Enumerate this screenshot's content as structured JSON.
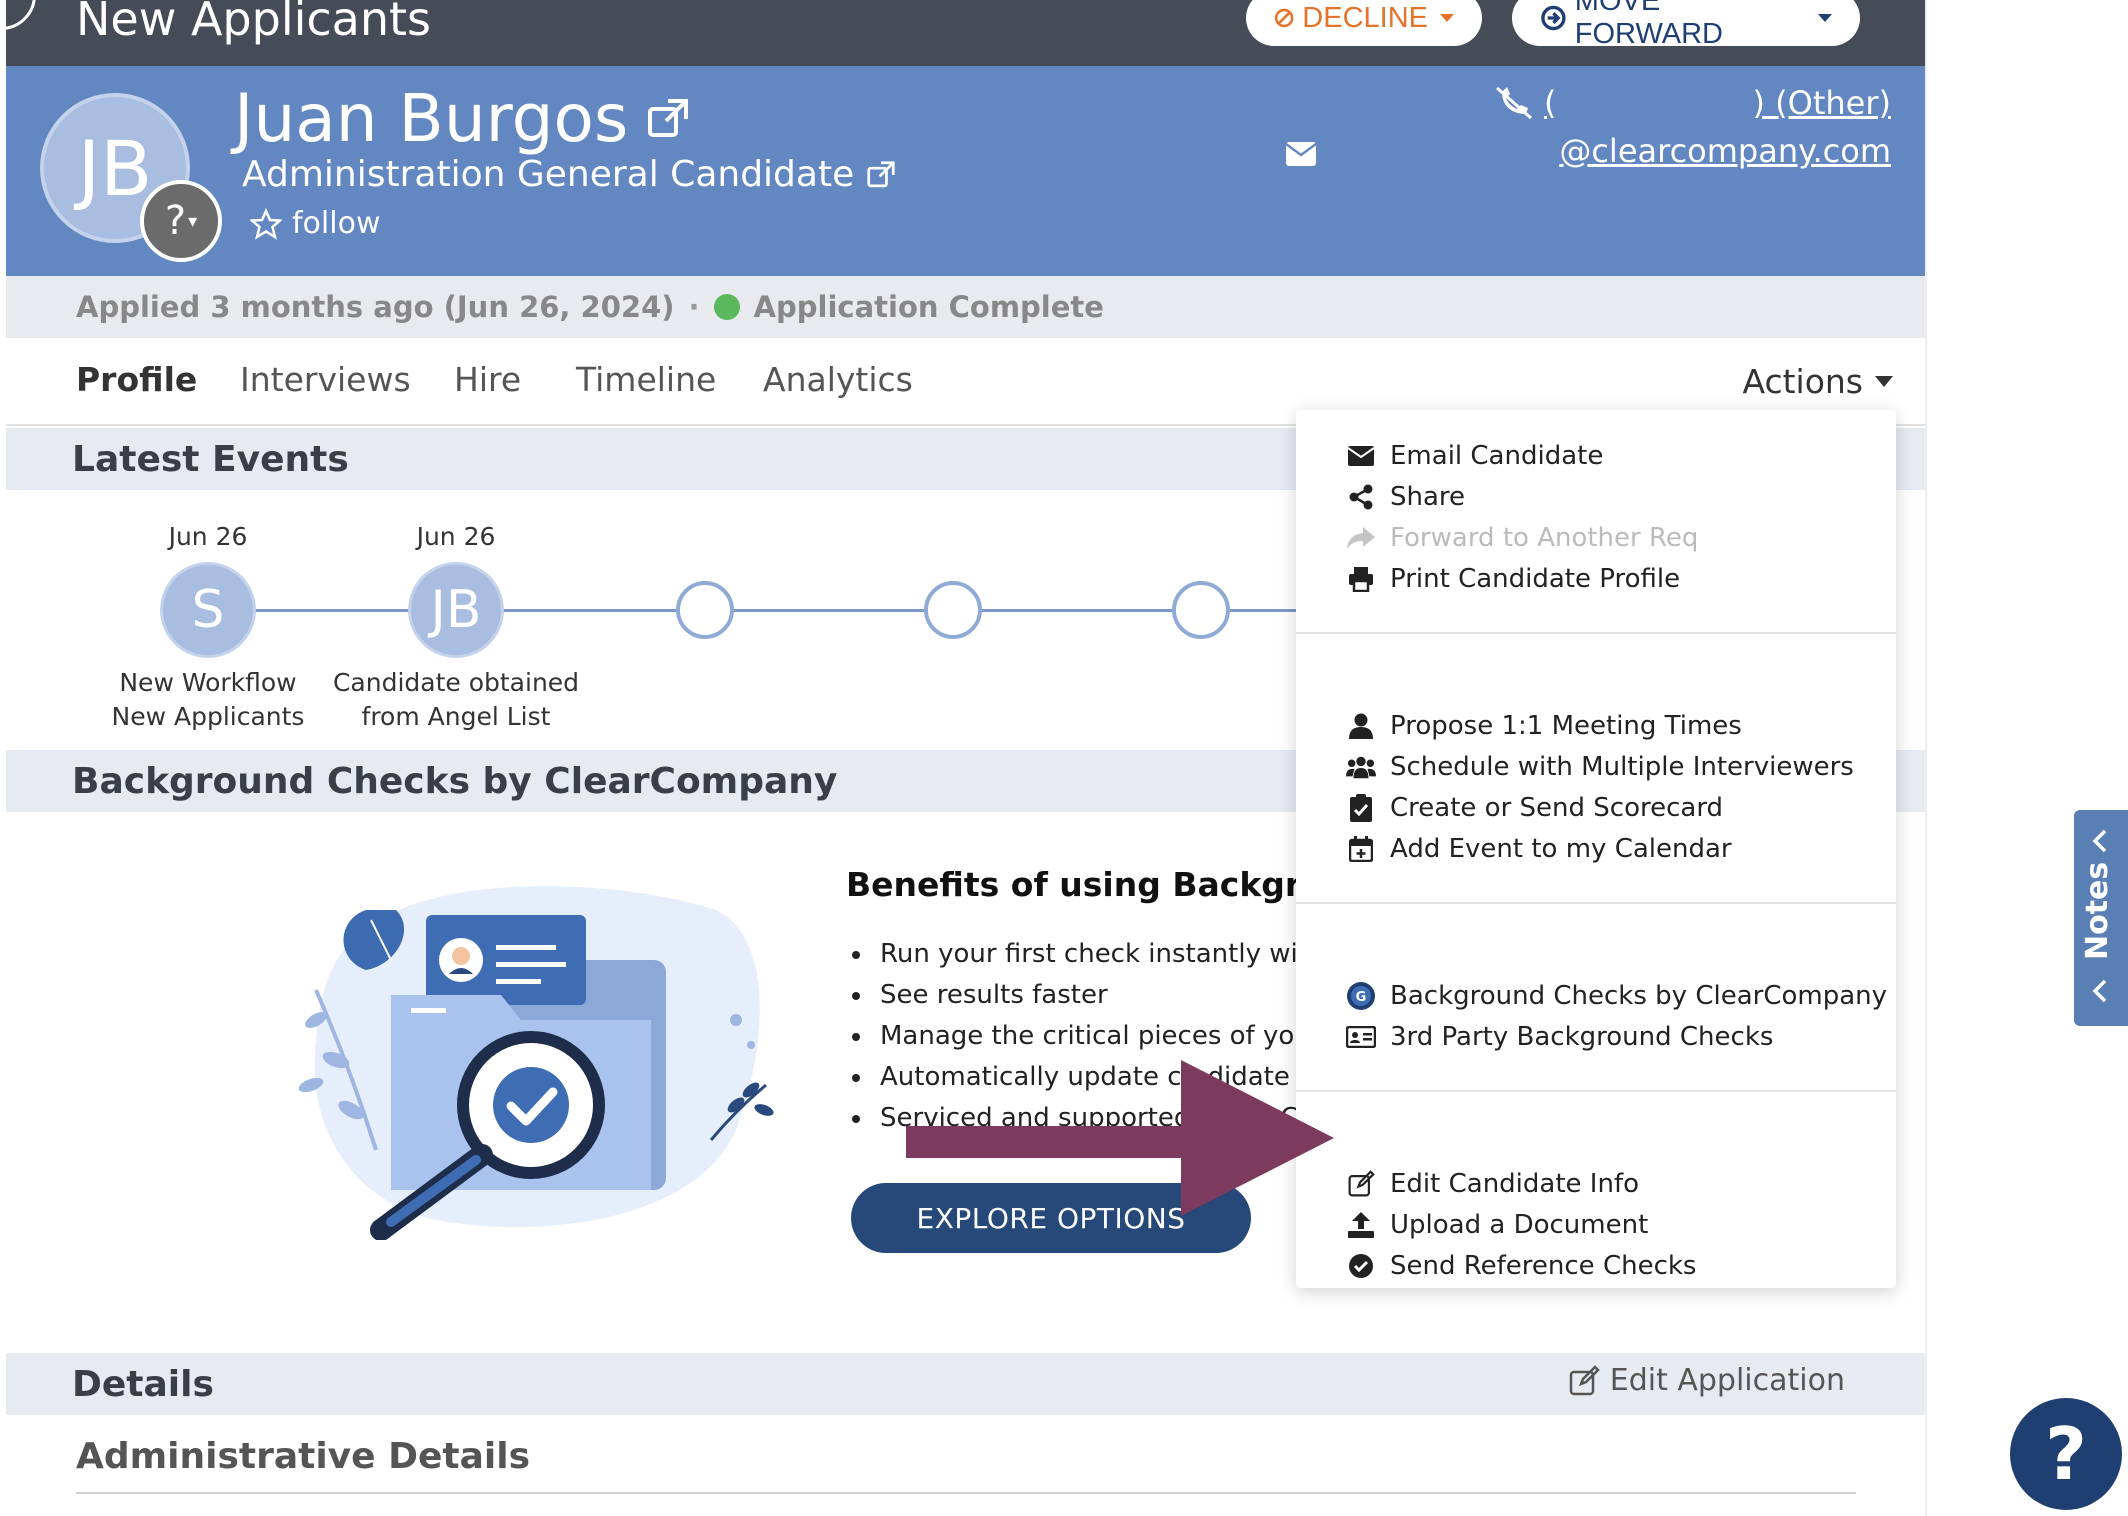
{
  "topbar": {
    "stage_title": "New Applicants",
    "decline_label": "DECLINE",
    "move_forward_label": "MOVE FORWARD"
  },
  "candidate": {
    "initials": "JB",
    "badge": "?",
    "name": "Juan Burgos",
    "role": "Administration General Candidate",
    "follow_label": "follow",
    "phone_left": "(",
    "phone_right": ") (Other)",
    "email": "@clearcompany.com"
  },
  "status": {
    "applied": "Applied 3 months ago (Jun 26, 2024)",
    "separator": "·",
    "application": "Application Complete",
    "status_color": "#5cb85c"
  },
  "tabs": [
    "Profile",
    "Interviews",
    "Hire",
    "Timeline",
    "Analytics"
  ],
  "actions_label": "Actions",
  "sections": {
    "latest_events": "Latest Events",
    "background_checks": "Background Checks by ClearCompany",
    "details": "Details",
    "edit_application": "Edit Application",
    "administrative_details": "Administrative Details"
  },
  "timeline": [
    {
      "date": "Jun 26",
      "initial": "S",
      "label_line1": "New Workflow",
      "label_line2": "New Applicants"
    },
    {
      "date": "Jun 26",
      "initial": "JB",
      "label_line1": "Candidate obtained",
      "label_line2": "from Angel List"
    }
  ],
  "benefits": {
    "title": "Benefits of using Backgroun",
    "items": [
      "Run your first check instantly with r",
      "See results faster",
      "Manage the critical pieces of your",
      "Automatically update ca",
      "Serviced and supported"
    ],
    "item4_tail": "didate w",
    "item5_tail": "C",
    "explore_label": "EXPLORE OPTIONS"
  },
  "actions_menu": {
    "group1": [
      {
        "label": "Email Candidate",
        "icon": "envelope-icon",
        "enabled": true
      },
      {
        "label": "Share",
        "icon": "share-icon",
        "enabled": true
      },
      {
        "label": "Forward to Another Req",
        "icon": "forward-icon",
        "enabled": false
      },
      {
        "label": "Print Candidate Profile",
        "icon": "print-icon",
        "enabled": true
      }
    ],
    "group2": [
      {
        "label": "Propose 1:1 Meeting Times",
        "icon": "user-icon"
      },
      {
        "label": "Schedule with Multiple Interviewers",
        "icon": "users-icon"
      },
      {
        "label": "Create or Send Scorecard",
        "icon": "clipboard-check-icon"
      },
      {
        "label": "Add Event to my Calendar",
        "icon": "calendar-plus-icon"
      }
    ],
    "group3": [
      {
        "label": "Background Checks by ClearCompany",
        "icon": "clearcompany-logo-icon"
      },
      {
        "label": "3rd Party Background Checks",
        "icon": "id-card-icon"
      }
    ],
    "group4": [
      {
        "label": "Edit Candidate Info",
        "icon": "edit-icon"
      },
      {
        "label": "Upload a Document",
        "icon": "upload-icon"
      },
      {
        "label": "Send Reference Checks",
        "icon": "check-circle-icon"
      }
    ]
  },
  "notes_label": "Notes",
  "help_label": "?",
  "colors": {
    "topbar": "#454c57",
    "header": "#6388c1",
    "decline": "#e5732a",
    "primary": "#26497a",
    "arrow": "#7b3a5e"
  }
}
